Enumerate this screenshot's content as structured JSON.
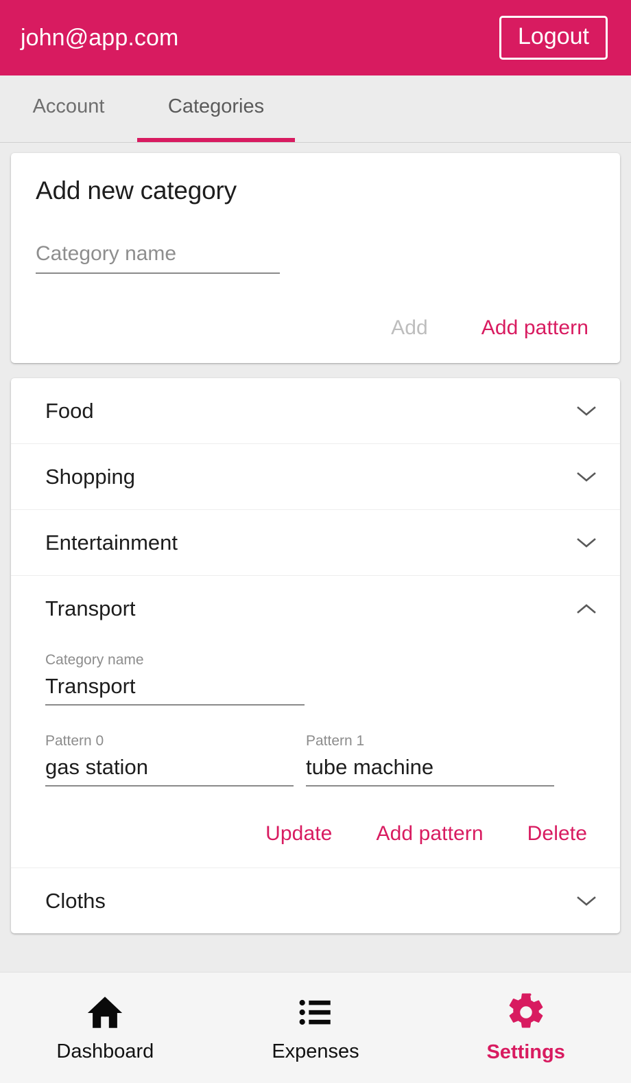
{
  "header": {
    "account_email": "john@app.com",
    "logout_label": "Logout",
    "background_color": "#d81b60"
  },
  "tabs": [
    {
      "label": "Account",
      "active": false
    },
    {
      "label": "Categories",
      "active": true
    }
  ],
  "add_category_card": {
    "title": "Add new category",
    "name_input": {
      "value": "",
      "placeholder": "Category name"
    },
    "add_button": {
      "label": "Add",
      "disabled": true
    },
    "add_pattern_button": {
      "label": "Add pattern",
      "disabled": false
    }
  },
  "categories": [
    {
      "name": "Food",
      "expanded": false,
      "chevron": "chevron-down-icon"
    },
    {
      "name": "Shopping",
      "expanded": false,
      "chevron": "chevron-down-icon"
    },
    {
      "name": "Entertainment",
      "expanded": false,
      "chevron": "chevron-down-icon"
    },
    {
      "name": "Transport",
      "expanded": true,
      "chevron": "chevron-up-icon",
      "detail": {
        "name_label": "Category name",
        "name_value": "Transport",
        "patterns": [
          {
            "label": "Pattern 0",
            "value": "gas station"
          },
          {
            "label": "Pattern 1",
            "value": "tube machine"
          }
        ],
        "actions": {
          "update_label": "Update",
          "add_pattern_label": "Add pattern",
          "delete_label": "Delete"
        }
      }
    },
    {
      "name": "Cloths",
      "expanded": false,
      "chevron": "chevron-down-icon"
    }
  ],
  "bottom_nav": [
    {
      "label": "Dashboard",
      "icon": "home-icon",
      "active": false,
      "color": "#111111"
    },
    {
      "label": "Expenses",
      "icon": "list-icon",
      "active": false,
      "color": "#111111"
    },
    {
      "label": "Settings",
      "icon": "gear-icon",
      "active": true,
      "color": "#d81b60"
    }
  ],
  "theme": {
    "accent": "#d81b60",
    "page_background": "#ececec",
    "card_background": "#ffffff",
    "disabled_text": "#bdbdbd"
  }
}
